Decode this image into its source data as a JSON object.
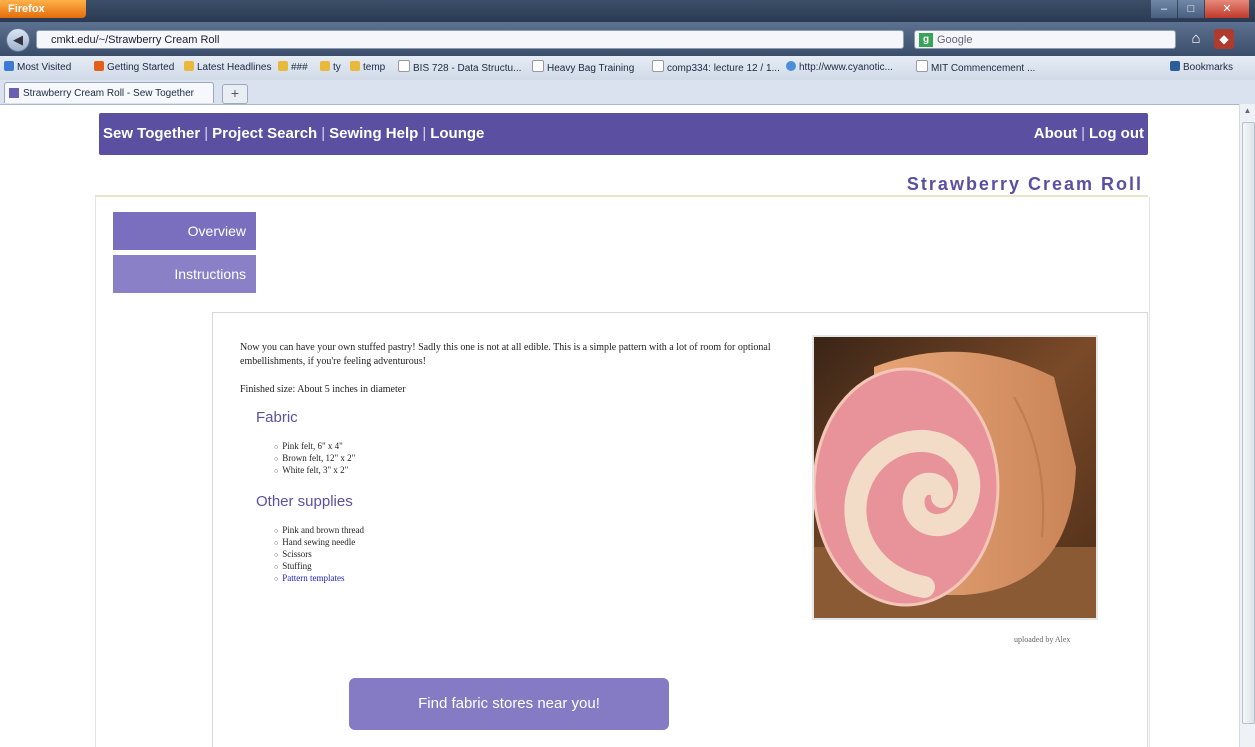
{
  "browser": {
    "app_button": "Firefox",
    "url": "cmkt.edu/~/Strawberry Cream Roll",
    "search_placeholder": "Google",
    "tab_title": "Strawberry Cream Roll - Sew Together",
    "bookmarks": [
      "Most Visited",
      "Getting Started",
      "Latest Headlines",
      "###",
      "ty",
      "temp",
      "BIS 728 - Data Structu...",
      "Heavy Bag Training",
      "comp334: lecture 12 / 1...",
      "http://www.cyanotic...",
      "MIT Commencement ..."
    ],
    "bookmarks_menu": "Bookmarks"
  },
  "site": {
    "nav_left": [
      "Sew Together",
      "Project Search",
      "Sewing Help",
      "Lounge"
    ],
    "nav_right": [
      "About",
      "Log out"
    ],
    "page_title": "Strawberry Cream Roll",
    "side_tabs": [
      "Overview",
      "Instructions"
    ],
    "intro": "Now you can have your own stuffed pastry! Sadly this one is not at all edible. This is a simple pattern with a lot of room for optional embellishments, if you're feeling adventurous!",
    "finished_size": "Finished size: About 5 inches in diameter",
    "fabric_heading": "Fabric",
    "fabric_items": [
      "Pink felt, 6\" x 4\"",
      "Brown felt, 12\" x 2\"",
      "White felt, 3\" x 2\""
    ],
    "supplies_heading": "Other supplies",
    "supplies_items": [
      "Pink and brown thread",
      "Hand sewing needle",
      "Scissors",
      "Stuffing",
      "Pattern templates"
    ],
    "photo_credit": "uploaded by Alex",
    "find_button": "Find fabric stores near you!"
  },
  "colors": {
    "brand": "#5b4fa2",
    "side_tab": "#8a80c8",
    "button": "#857ac4"
  }
}
